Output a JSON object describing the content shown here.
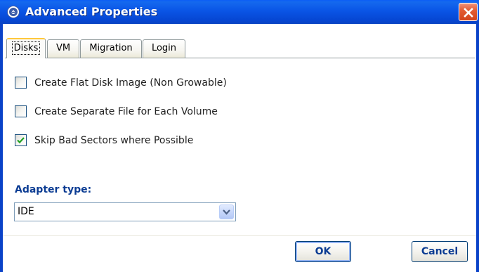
{
  "window": {
    "title": "Advanced Properties",
    "title_icon": "app-icon",
    "close_icon": "close-icon"
  },
  "tabs": [
    {
      "label": "Disks",
      "active": true
    },
    {
      "label": "VM",
      "active": false
    },
    {
      "label": "Migration",
      "active": false
    },
    {
      "label": "Login",
      "active": false
    }
  ],
  "disks": {
    "options": [
      {
        "label": "Create Flat Disk Image (Non Growable)",
        "checked": false
      },
      {
        "label": "Create Separate File for Each Volume",
        "checked": false
      },
      {
        "label": "Skip Bad Sectors where Possible",
        "checked": true
      }
    ],
    "adapter_label": "Adapter type:",
    "adapter_value": "IDE",
    "dropdown_icon": "chevron-down-icon"
  },
  "buttons": {
    "ok": "OK",
    "cancel": "Cancel"
  },
  "colors": {
    "titlebar": "#0A55E6",
    "frame": "#0A42C8",
    "label_accent": "#0B3C93",
    "close": "#E35C33"
  }
}
